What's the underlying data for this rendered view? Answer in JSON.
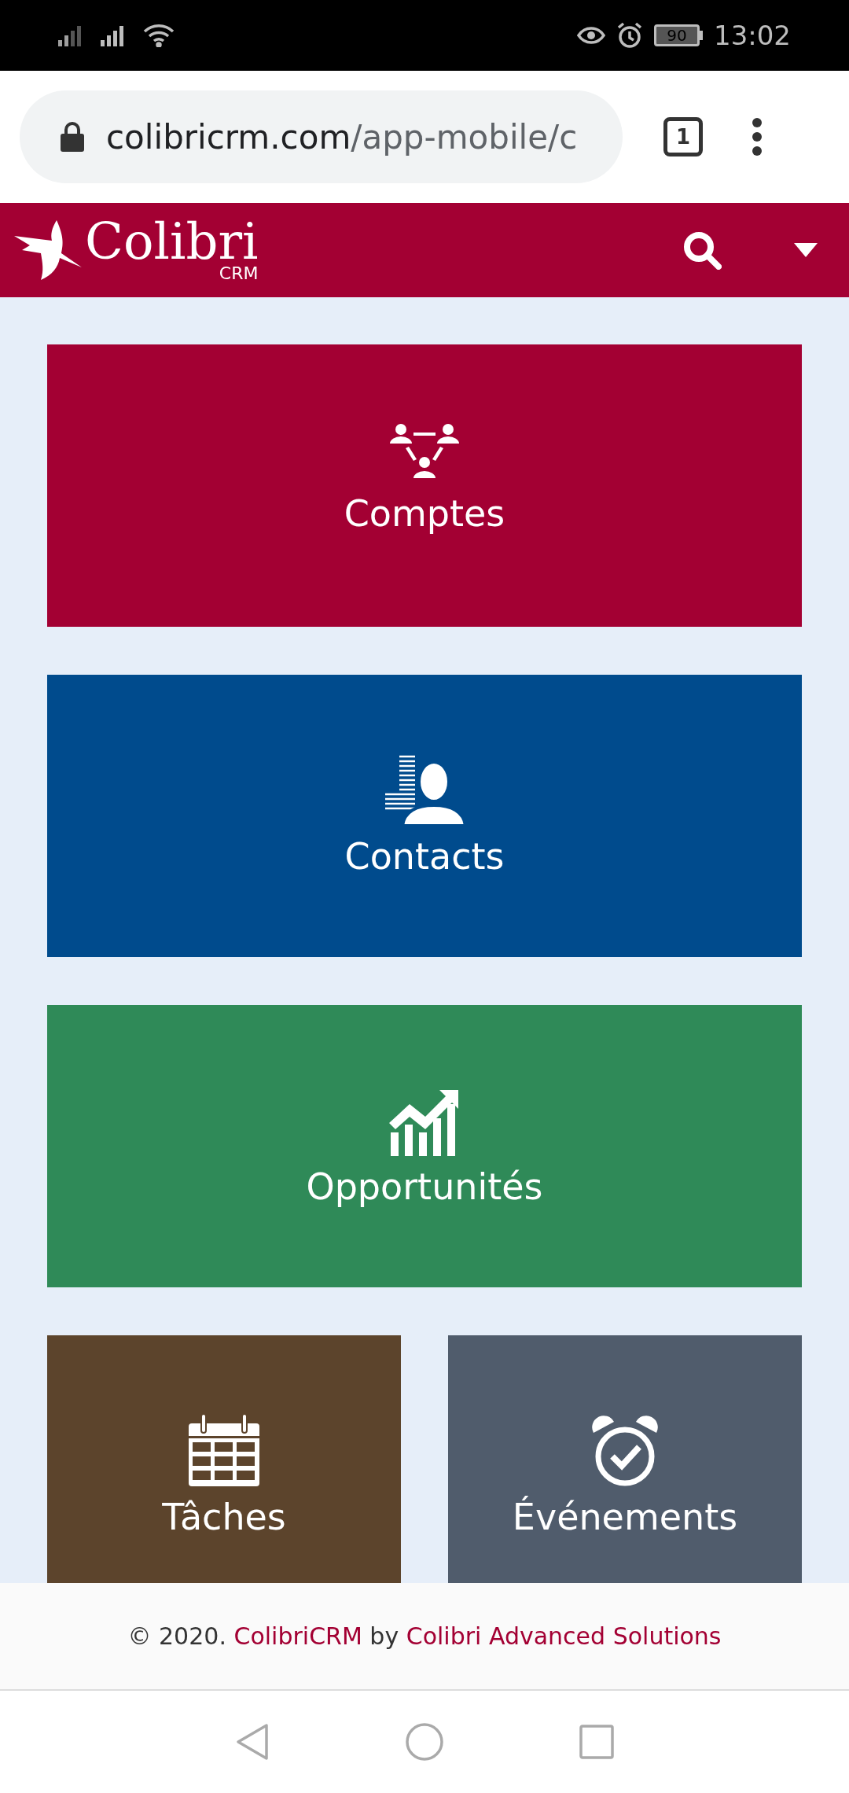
{
  "status_bar": {
    "battery": "90",
    "time": "13:02"
  },
  "browser": {
    "url_host": "colibricrm.com",
    "url_path": "/app-mobile/c",
    "tab_count": "1"
  },
  "header": {
    "logo_name": "Colibri",
    "logo_sub": "CRM"
  },
  "tiles": [
    {
      "label": "Comptes",
      "kind": "accounts",
      "color": "#a30033",
      "wide": true
    },
    {
      "label": "Contacts",
      "kind": "contacts",
      "color": "#004b8d",
      "wide": true
    },
    {
      "label": "Opportunités",
      "kind": "opportunities",
      "color": "#2f8a58",
      "wide": true
    },
    {
      "label": "Tâches",
      "kind": "tasks",
      "color": "#5c442c",
      "wide": false
    },
    {
      "label": "Événements",
      "kind": "events",
      "color": "#505c6c",
      "wide": false
    }
  ],
  "footer": {
    "prefix": "© 2020. ",
    "link1": "ColibriCRM",
    "middle": " by ",
    "link2": "Colibri Advanced Solutions"
  }
}
